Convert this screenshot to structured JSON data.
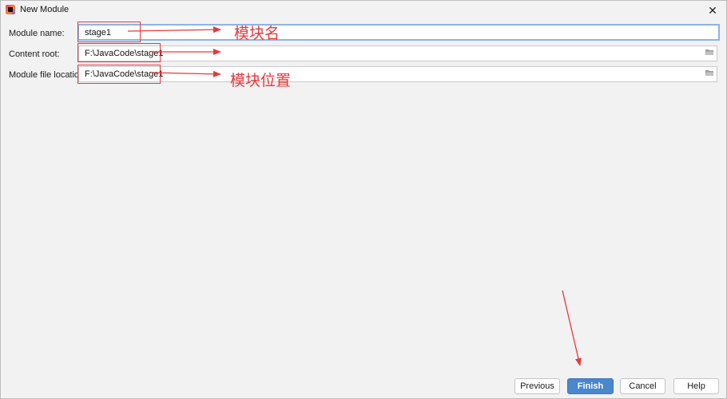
{
  "window": {
    "title": "New Module"
  },
  "form": {
    "module_name": {
      "label": "Module name:",
      "value": "stage1"
    },
    "content_root": {
      "label": "Content root:",
      "value": "F:\\JavaCode\\stage1"
    },
    "module_file_location": {
      "label": "Module file location:",
      "value": "F:\\JavaCode\\stage1"
    }
  },
  "annotations": {
    "module_name_note": "模块名",
    "location_note": "模块位置"
  },
  "buttons": {
    "previous": "Previous",
    "finish": "Finish",
    "cancel": "Cancel",
    "help": "Help"
  },
  "icons": {
    "app": "intellij-app-icon",
    "close": "close-icon",
    "folder": "folder-icon"
  },
  "colors": {
    "annotation": "#e5393e",
    "primary_button": "#4a87cc",
    "focus_border": "#8bb4e8"
  }
}
